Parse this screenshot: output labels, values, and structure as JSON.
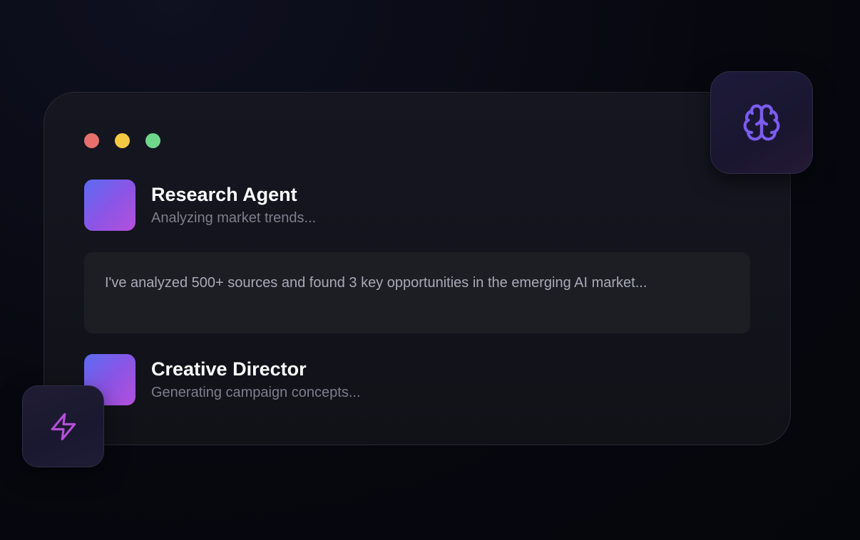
{
  "window": {
    "traffic_lights": [
      {
        "name": "close",
        "color": "#e8706c"
      },
      {
        "name": "minimize",
        "color": "#f5c944"
      },
      {
        "name": "maximize",
        "color": "#6ed88a"
      }
    ]
  },
  "agents": [
    {
      "name": "Research Agent",
      "status": "Analyzing market trends..."
    },
    {
      "name": "Creative Director",
      "status": "Generating campaign concepts..."
    }
  ],
  "message": {
    "text": "I've analyzed 500+ sources and found 3 key opportunities in the emerging AI market..."
  },
  "icons": {
    "brain": {
      "name": "brain-icon",
      "color": "#7b5cf0"
    },
    "bolt": {
      "name": "lightning-bolt-icon",
      "color": "#b44fd8"
    }
  },
  "colors": {
    "avatar_gradient_start": "#5b6cf2",
    "avatar_gradient_end": "#b64fdc"
  }
}
